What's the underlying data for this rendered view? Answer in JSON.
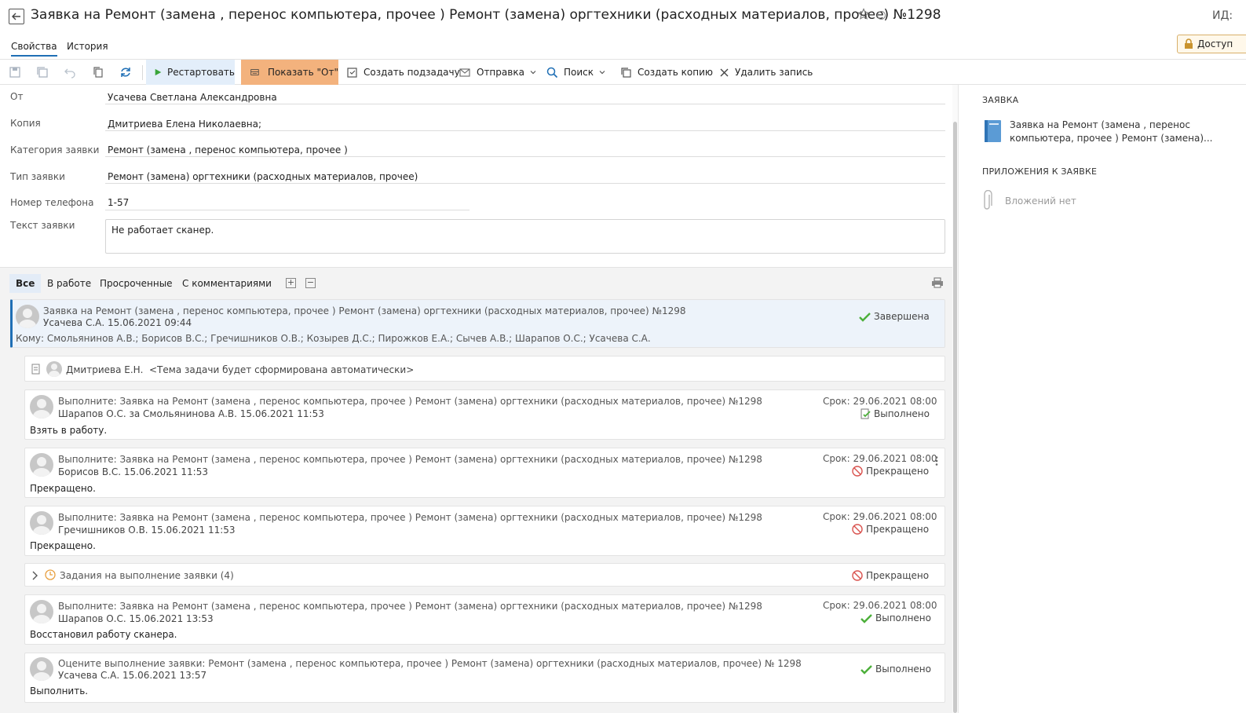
{
  "header": {
    "title": "Заявка на Ремонт (замена , перенос компьютера, прочее ) Ремонт (замена) оргтехники (расходных материалов, прочее) №1298",
    "id_label": "ИД:"
  },
  "tabs": [
    {
      "label": "Свойства",
      "active": true
    },
    {
      "label": "История",
      "active": false
    }
  ],
  "access_button": {
    "label": "Доступ"
  },
  "toolbar": {
    "restart": "Рестартовать",
    "show_from": "Показать \"От\"",
    "create_subtask": "Создать подзадачу",
    "send": "Отправка",
    "search": "Поиск",
    "create_copy": "Создать копию",
    "delete": "Удалить запись"
  },
  "form": {
    "from": {
      "label": "От",
      "value": "Усачева Светлана Александровна"
    },
    "copy": {
      "label": "Копия",
      "value": "Дмитриева Елена Николаевна;"
    },
    "category": {
      "label": "Категория заявки",
      "value": "Ремонт (замена , перенос компьютера, прочее )"
    },
    "type": {
      "label": "Тип заявки",
      "value": "Ремонт (замена) оргтехники (расходных материалов, прочее)"
    },
    "phone": {
      "label": "Номер телефона",
      "value": "1-57"
    },
    "text": {
      "label": "Текст заявки",
      "value": "Не работает сканер."
    }
  },
  "filters": [
    {
      "label": "Все",
      "active": true
    },
    {
      "label": "В работе",
      "active": false
    },
    {
      "label": "Просроченные",
      "active": false
    },
    {
      "label": "С комментариями",
      "active": false
    }
  ],
  "main_card": {
    "title": "Заявка на Ремонт (замена , перенос компьютера, прочее ) Ремонт (замена) оргтехники (расходных материалов, прочее) №1298",
    "sub": "Усачева С.А.  15.06.2021 09:44",
    "recipients": "Кому: Смольянинов А.В.; Борисов В.С.; Гречишников О.В.; Козырев Д.С.; Пирожков Е.А.; Сычев А.В.; Шарапов О.С.; Усачева С.А.",
    "status": "Завершена"
  },
  "draft_card": {
    "author": "Дмитриева Е.Н.",
    "subject": "<Тема задачи будет сформирована автоматически>"
  },
  "tasks": [
    {
      "title": "Выполните: Заявка на Ремонт (замена , перенос компьютера, прочее ) Ремонт (замена) оргтехники (расходных материалов, прочее) №1298",
      "sub": "Шарапов О.С. за Смольянинова А.В.  15.06.2021 11:53",
      "body": "Взять в работу.",
      "due": "Срок: 29.06.2021 08:00",
      "status": "Выполнено"
    },
    {
      "title": "Выполните: Заявка на Ремонт (замена , перенос компьютера, прочее ) Ремонт (замена) оргтехники (расходных материалов, прочее) №1298",
      "sub": "Борисов В.С.  15.06.2021 11:53",
      "body": "Прекращено.",
      "due": "Срок: 29.06.2021 08:00",
      "status": "Прекращено"
    },
    {
      "title": "Выполните: Заявка на Ремонт (замена , перенос компьютера, прочее ) Ремонт (замена) оргтехники (расходных материалов, прочее) №1298",
      "sub": "Гречишников О.В.  15.06.2021 11:53",
      "body": "Прекращено.",
      "due": "Срок: 29.06.2021 08:00",
      "status": "Прекращено"
    }
  ],
  "group_row": {
    "label": "Задания на выполнение заявки (4)",
    "status": "Прекращено"
  },
  "tasks2": [
    {
      "title": "Выполните: Заявка на Ремонт (замена , перенос компьютера, прочее ) Ремонт (замена) оргтехники (расходных материалов, прочее) №1298",
      "sub": "Шарапов О.С.  15.06.2021 13:53",
      "body": "Восстановил работу сканера.",
      "due": "Срок: 29.06.2021 08:00",
      "status": "Выполнено"
    },
    {
      "title": "Оцените выполнение заявки: Ремонт (замена , перенос компьютера, прочее ) Ремонт (замена) оргтехники (расходных материалов, прочее) № 1298",
      "sub": "Усачева С.А.  15.06.2021 13:57",
      "body": "Выполнить.",
      "status": "Выполнено"
    }
  ],
  "sidebar": {
    "request_heading": "ЗАЯВКА",
    "request_doc": "Заявка на Ремонт (замена , перенос компьютера, прочее ) Ремонт (замена)...",
    "attachments_heading": "ПРИЛОЖЕНИЯ К ЗАЯВКЕ",
    "attachments_empty": "Вложений нет"
  },
  "colors": {
    "accent": "#1f6fb5",
    "show_from_bg": "#f3b27d",
    "success": "#4caf3a",
    "cancel": "#d9534f"
  }
}
